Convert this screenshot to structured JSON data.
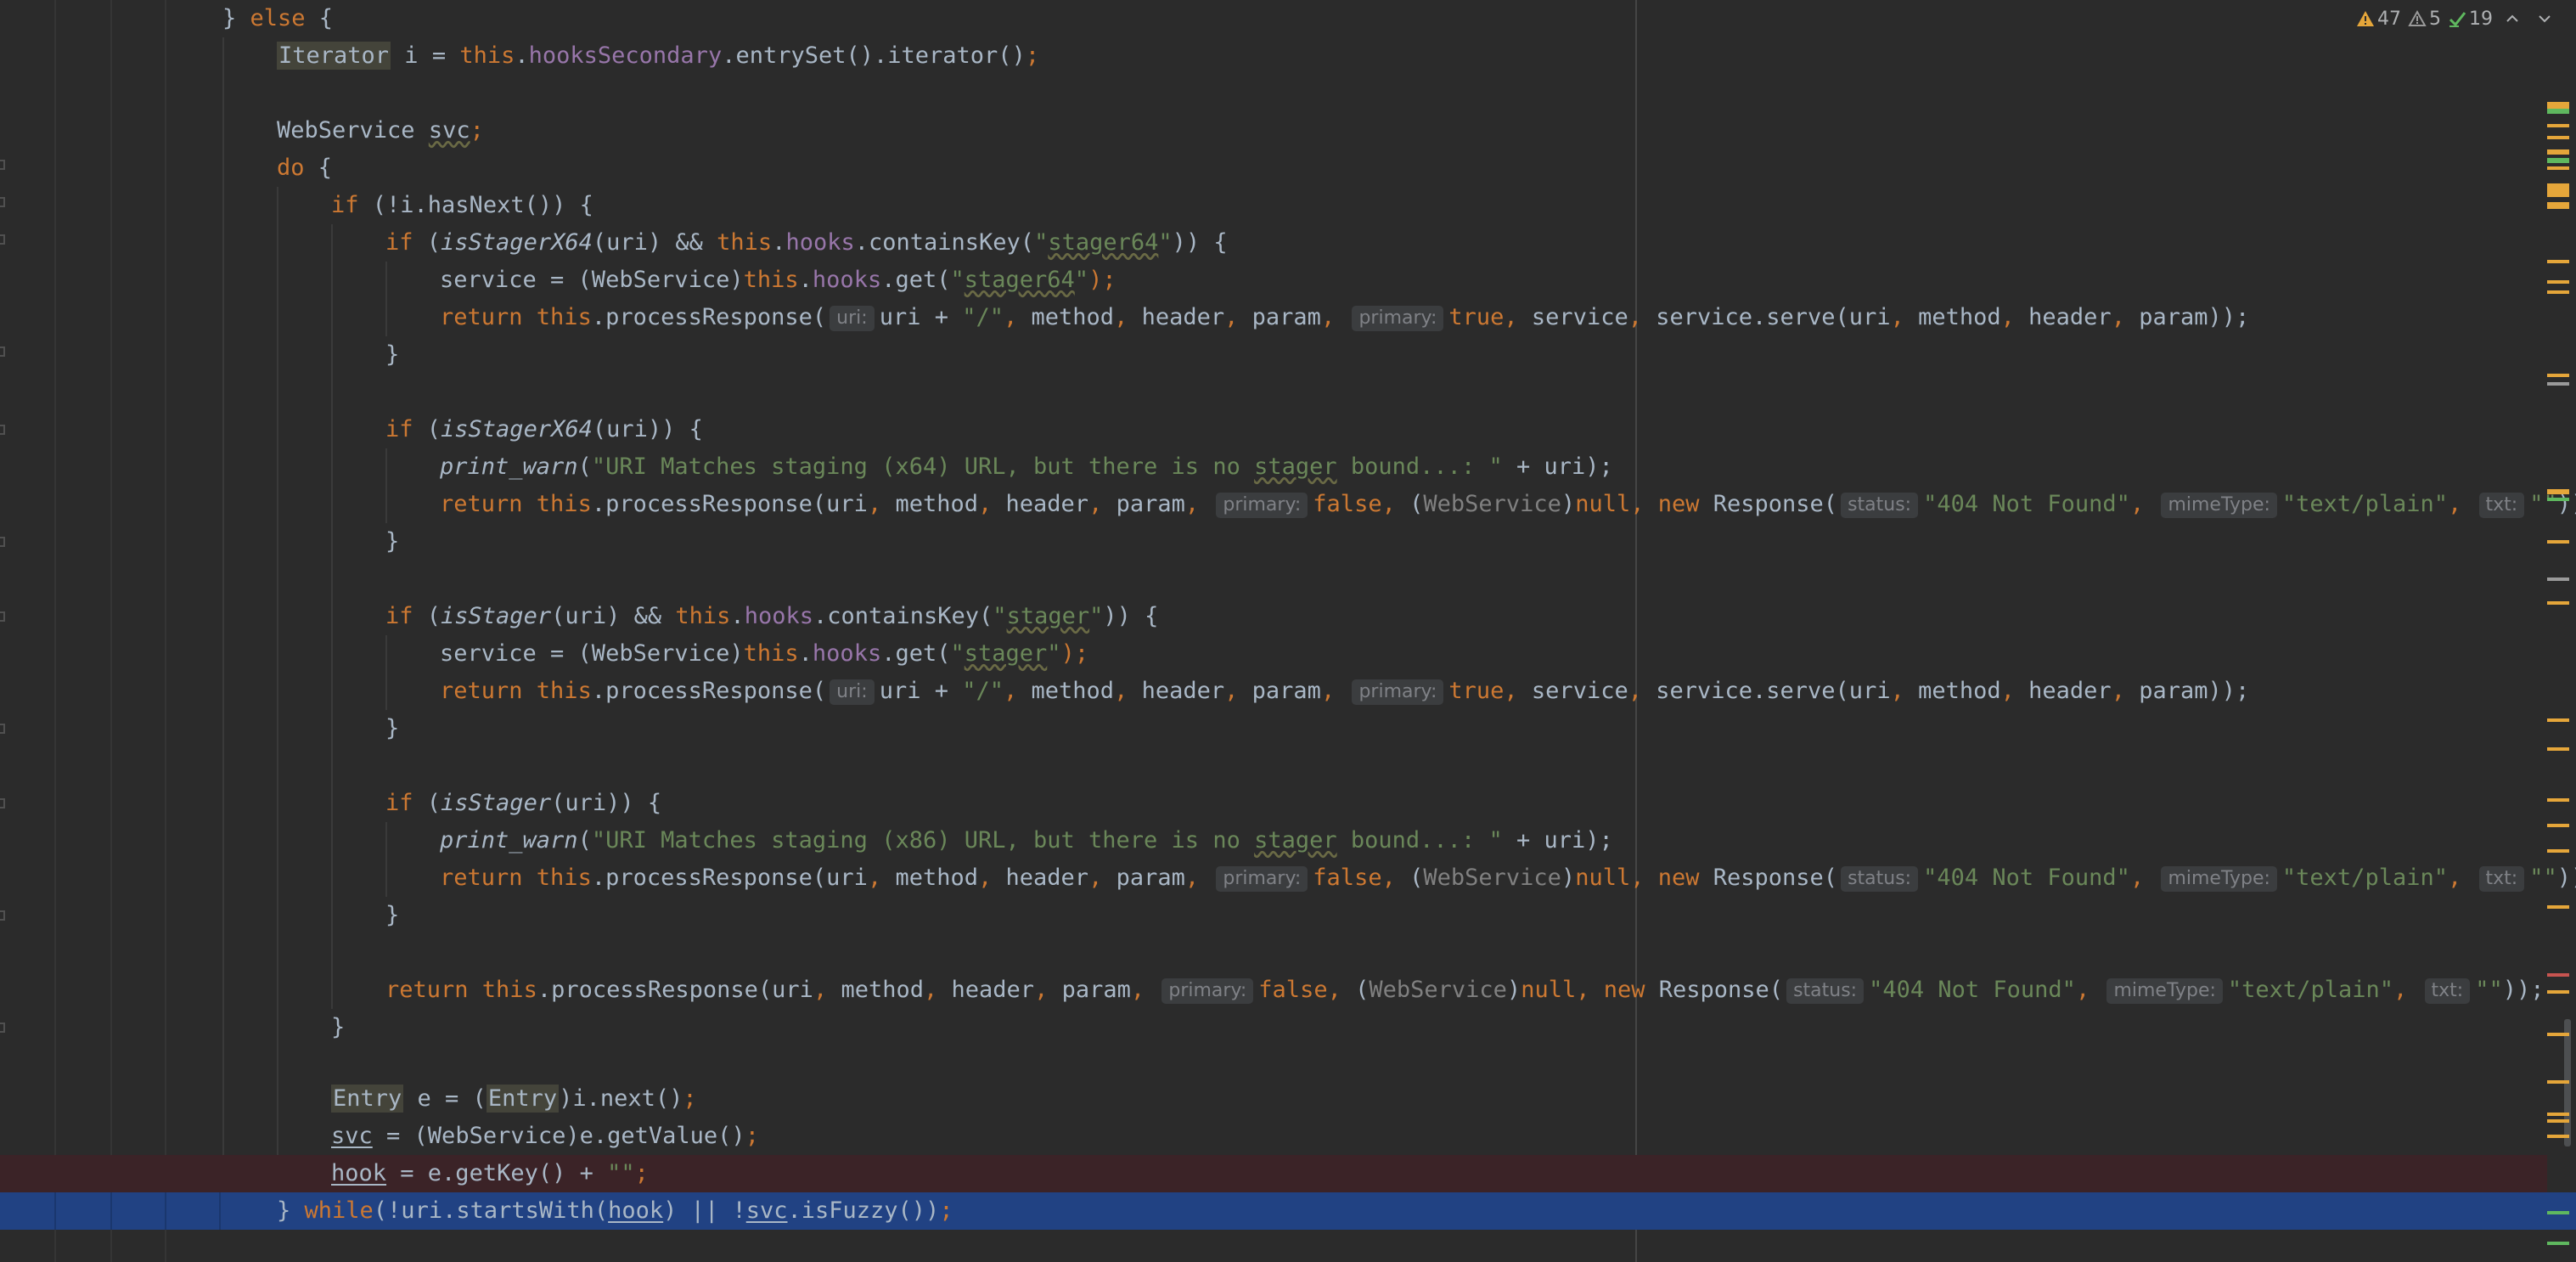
{
  "editor": {
    "lines": {
      "l01": {
        "a": "} ",
        "b": "else",
        " c": "",
        " d": ""
      },
      "l02": {
        "a": "Iterator",
        "b": " i = ",
        "c": "this",
        ".": ".",
        "d": "hooksSecondary",
        "e": ".entrySet().iterator()",
        "f": ";"
      },
      "l03": {
        "a": "WebService ",
        "b": "svc",
        "c": ";"
      },
      "l04": {
        "a": "do",
        "b": " {"
      },
      "l05": {
        "a": "if",
        "b": " (!i.hasNext()) {"
      },
      "l06": {
        "a": "if",
        "b": " (",
        "c": "isStagerX64",
        "d": "(uri) && ",
        "e": "this",
        "f": ".",
        "g": "hooks",
        "h": ".containsKey(",
        "i": "\"",
        "j": "stager64",
        "k": "\"",
        "l": ")) {"
      },
      "l07": {
        "a": "service = (WebService)",
        "b": "this",
        "c": ".",
        "d": "hooks",
        "e": ".get(",
        "f": "\"",
        "g": "stager64",
        "h": "\"",
        "i": ");"
      },
      "l08": {
        "a": "return ",
        "b": "this",
        "c": ".processResponse(",
        "h1": "uri:",
        "d": "uri + ",
        "e": "\"/\"",
        ",1": ", ",
        "f": "method",
        ",2": ", ",
        "g": "header",
        ",3": ", ",
        "h": "param",
        ",4": ", ",
        "h2": "primary:",
        "i": "true",
        ",5": ", ",
        "j": "service",
        ",6": ", ",
        "k": "service.serve(uri",
        ",7": ", ",
        "l": "method",
        ",8": ", ",
        "m": "header",
        ",9": ", ",
        "n": "param));"
      },
      "l09": {
        "a": "}"
      },
      "l10": {
        "a": "if",
        "b": " (",
        "c": "isStagerX64",
        "d": "(uri)) {"
      },
      "l11": {
        "a": "print_warn",
        "b": "(",
        "c": "\"URI Matches staging (x64) URL, but there is no ",
        "d": "stager",
        "e": " bound...: \"",
        "f": " + uri);"
      },
      "l12": {
        "a": "return ",
        "b": "this",
        "c": ".processResponse(uri",
        ",1": ", ",
        "d": "method",
        ",2": ", ",
        "e": "header",
        ",3": ", ",
        "f": "param",
        ",4": ", ",
        "h1": "primary:",
        "g": "false",
        ",5": ", ",
        "h": "(",
        "i": "WebService",
        "j": ")",
        "k": "null",
        ",6": ", ",
        "l": "new ",
        "m": "Response(",
        "h2": "status:",
        "n": "\"404 Not Found\"",
        ",7": ", ",
        "h3": "mimeType:",
        "o": "\"text/plain\"",
        ",8": ", ",
        "h4": "txt:",
        "p": "\"\"",
        "q": "));"
      },
      "l13": {
        "a": "}"
      },
      "l14": {
        "a": "if",
        "b": " (",
        "c": "isStager",
        "d": "(uri) && ",
        "e": "this",
        "f": ".",
        "g": "hooks",
        "h": ".containsKey(",
        "i": "\"",
        "j": "stager",
        "k": "\"",
        "l": ")) {"
      },
      "l15": {
        "a": "service = (WebService)",
        "b": "this",
        "c": ".",
        "d": "hooks",
        "e": ".get(",
        "f": "\"",
        "g": "stager",
        "h": "\"",
        "i": ");"
      },
      "l16": {
        "a": "return ",
        "b": "this",
        "c": ".processResponse(",
        "h1": "uri:",
        "d": "uri + ",
        "e": "\"/\"",
        ",1": ", ",
        "f": "method",
        ",2": ", ",
        "g": "header",
        ",3": ", ",
        "h": "param",
        ",4": ", ",
        "h2": "primary:",
        "i": "true",
        ",5": ", ",
        "j": "service",
        ",6": ", ",
        "k": "service.serve(uri",
        ",7": ", ",
        "l": "method",
        ",8": ", ",
        "m": "header",
        ",9": ", ",
        "n": "param));"
      },
      "l17": {
        "a": "}"
      },
      "l18": {
        "a": "if",
        "b": " (",
        "c": "isStager",
        "d": "(uri)) {"
      },
      "l19": {
        "a": "print_warn",
        "b": "(",
        "c": "\"URI Matches staging (x86) URL, but there is no ",
        "d": "stager",
        "e": " bound...: \"",
        "f": " + uri);"
      },
      "l20": {
        "a": "return ",
        "b": "this",
        "c": ".processResponse(uri",
        ",1": ", ",
        "d": "method",
        ",2": ", ",
        "e": "header",
        ",3": ", ",
        "f": "param",
        ",4": ", ",
        "h1": "primary:",
        "g": "false",
        ",5": ", ",
        "h": "(",
        "i": "WebService",
        "j": ")",
        "k": "null",
        ",6": ", ",
        "l": "new ",
        "m": "Response(",
        "h2": "status:",
        "n": "\"404 Not Found\"",
        ",7": ", ",
        "h3": "mimeType:",
        "o": "\"text/plain\"",
        ",8": ", ",
        "h4": "txt:",
        "p": "\"\"",
        "q": "));"
      },
      "l21": {
        "a": "}"
      },
      "l22": {
        "a": "return ",
        "b": "this",
        "c": ".processResponse(uri",
        ",1": ", ",
        "d": "method",
        ",2": ", ",
        "e": "header",
        ",3": ", ",
        "f": "param",
        ",4": ", ",
        "h1": "primary:",
        "g": "false",
        ",5": ", ",
        "h": "(",
        "i": "WebService",
        "j": ")",
        "k": "null",
        ",6": ", ",
        "l": "new ",
        "m": "Response(",
        "h2": "status:",
        "n": "\"404 Not Found\"",
        ",7": ", ",
        "h3": "mimeType:",
        "o": "\"text/plain\"",
        ",8": ", ",
        "h4": "txt:",
        "p": "\"\"",
        "q": "));"
      },
      "l23": {
        "a": "}"
      },
      "l24": {
        "a": "Entry",
        "b": " e = (",
        "c": "Entry",
        "d": ")i.next()",
        "e": ";"
      },
      "l25": {
        "a": "svc",
        "b": " = (WebService)e.getValue()",
        "c": ";"
      },
      "l26": {
        "a": "hook",
        "b": " = e.getKey() + ",
        "c": "\"\"",
        "d": ";"
      },
      "l27": {
        "a": "} ",
        "b": "while",
        "c": "(!uri.startsWith(",
        "d": "hook",
        "e": ") || !",
        "f": "svc",
        "g": ".isFuzzy())",
        "h": ";"
      }
    }
  },
  "inspections": {
    "warnings": "47",
    "weak_warnings": "5",
    "typos": "19",
    "warning_color": "#e5a63a",
    "ok_color": "#5fb85f"
  }
}
